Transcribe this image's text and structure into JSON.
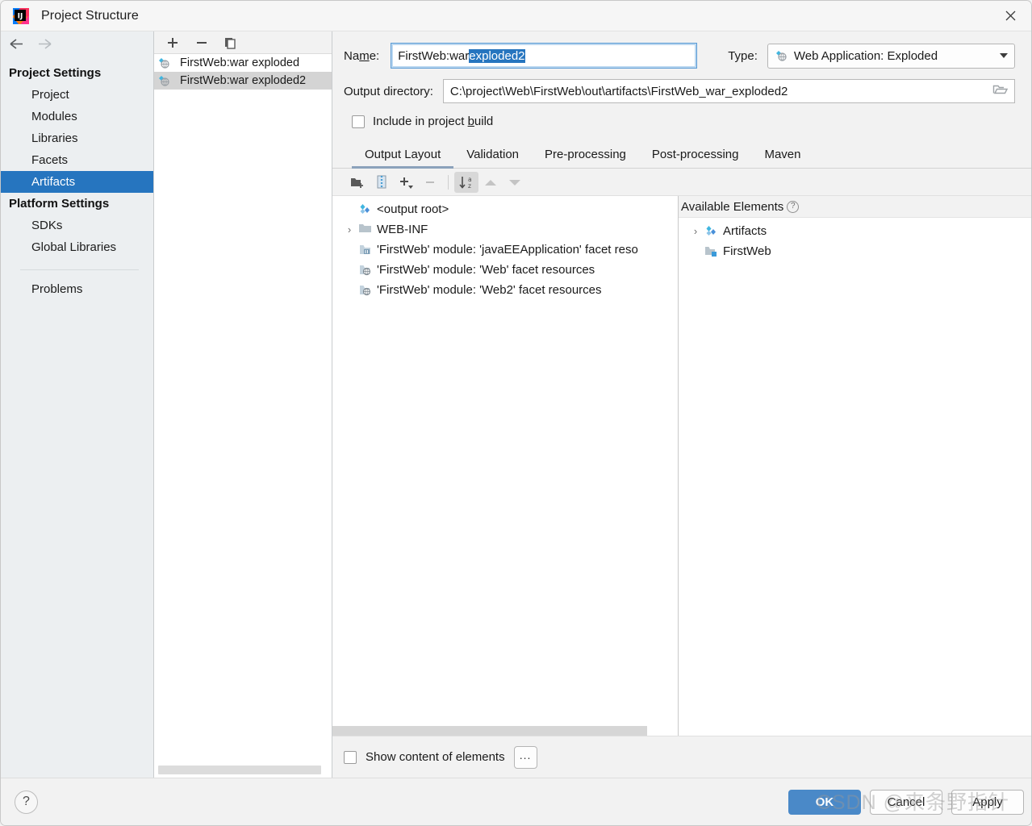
{
  "window": {
    "title": "Project Structure",
    "logo_icon": "intellij-idea-logo",
    "close_icon": "close-icon"
  },
  "sidebar": {
    "back_icon": "arrow-left-icon",
    "forward_icon": "arrow-right-icon",
    "groups": [
      {
        "label": "Project Settings",
        "items": [
          {
            "label": "Project",
            "selected": false
          },
          {
            "label": "Modules",
            "selected": false
          },
          {
            "label": "Libraries",
            "selected": false
          },
          {
            "label": "Facets",
            "selected": false
          },
          {
            "label": "Artifacts",
            "selected": true
          }
        ]
      },
      {
        "label": "Platform Settings",
        "items": [
          {
            "label": "SDKs",
            "selected": false
          },
          {
            "label": "Global Libraries",
            "selected": false
          }
        ]
      }
    ],
    "problems_label": "Problems"
  },
  "artifacts_panel": {
    "toolbar": {
      "add_icon": "plus-icon",
      "remove_icon": "minus-icon",
      "copy_icon": "copy-icon"
    },
    "items": [
      {
        "label": "FirstWeb:war exploded",
        "icon": "web-artifact-icon",
        "selected": false
      },
      {
        "label": "FirstWeb:war exploded2",
        "icon": "web-artifact-icon",
        "selected": true
      }
    ]
  },
  "detail": {
    "name_label": "Name:",
    "name_label_prefix": "Na",
    "name_label_mnemonic": "m",
    "name_label_suffix": "e:",
    "name_value_unselected": "FirstWeb:war ",
    "name_value_selected": "exploded2",
    "type_label": "Type:",
    "type_value": "Web Application: Exploded",
    "type_icon": "web-artifact-icon",
    "type_caret_icon": "chevron-down-icon",
    "output_dir_label": "Output directory:",
    "output_dir_value": "C:\\project\\Web\\FirstWeb\\out\\artifacts\\FirstWeb_war_exploded2",
    "browse_icon": "folder-open-icon",
    "include_build_prefix": "Include in project ",
    "include_build_mnemonic": "b",
    "include_build_suffix": "uild",
    "include_build_checked": false,
    "tabs": [
      {
        "label": "Output Layout",
        "active": true
      },
      {
        "label": "Validation",
        "active": false
      },
      {
        "label": "Pre-processing",
        "active": false
      },
      {
        "label": "Post-processing",
        "active": false
      },
      {
        "label": "Maven",
        "active": false
      }
    ]
  },
  "layout_toolbar": {
    "buttons": [
      {
        "name": "create-directory-icon",
        "glyph": "folder-plus",
        "state": "enabled"
      },
      {
        "name": "create-archive-icon",
        "glyph": "archive",
        "state": "enabled"
      },
      {
        "name": "add-copy-of-icon",
        "glyph": "plus-dropdown",
        "state": "enabled"
      },
      {
        "name": "remove-icon",
        "glyph": "minus",
        "state": "disabled"
      },
      {
        "name": "sort-alphabetically-icon",
        "glyph": "sort-az",
        "state": "toggled"
      },
      {
        "name": "move-up-icon",
        "glyph": "triangle-up",
        "state": "disabled"
      },
      {
        "name": "move-down-icon",
        "glyph": "triangle-down",
        "state": "disabled"
      }
    ]
  },
  "output_tree": {
    "nodes": [
      {
        "label": "<output root>",
        "icon": "artifact-root-icon",
        "indent": 0,
        "twisty": "none"
      },
      {
        "label": "WEB-INF",
        "icon": "folder-icon",
        "indent": 0,
        "twisty": "collapsed"
      },
      {
        "label": "'FirstWeb' module: 'javaEEApplication' facet reso",
        "icon": "javaee-facet-icon",
        "indent": 1,
        "twisty": "none"
      },
      {
        "label": "'FirstWeb' module: 'Web' facet resources",
        "icon": "web-facet-icon",
        "indent": 1,
        "twisty": "none"
      },
      {
        "label": "'FirstWeb' module: 'Web2' facet resources",
        "icon": "web-facet-icon",
        "indent": 1,
        "twisty": "none"
      }
    ]
  },
  "available_elements": {
    "title": "Available Elements",
    "help_icon": "help-icon",
    "help_glyph": "?",
    "nodes": [
      {
        "label": "Artifacts",
        "icon": "artifact-root-icon",
        "twisty": "collapsed"
      },
      {
        "label": "FirstWeb",
        "icon": "module-icon",
        "twisty": "none"
      }
    ]
  },
  "bottom_bar": {
    "show_content_label": "Show content of elements",
    "show_content_checked": false,
    "more_button_label": "..."
  },
  "footer": {
    "help_glyph": "?",
    "help_icon": "help-icon",
    "buttons": [
      {
        "label": "OK",
        "primary": true
      },
      {
        "label": "Cancel",
        "primary": false
      },
      {
        "label": "Apply",
        "primary": false
      }
    ]
  },
  "watermark": {
    "text": "CSDN @来条野指针"
  },
  "colors": {
    "accent_selection": "#2675bf",
    "primary_button": "#4a89c8",
    "sidebar_bg": "#eceff1",
    "list_selection": "#d4d4d4",
    "tab_underline": "#8ba2bb"
  }
}
